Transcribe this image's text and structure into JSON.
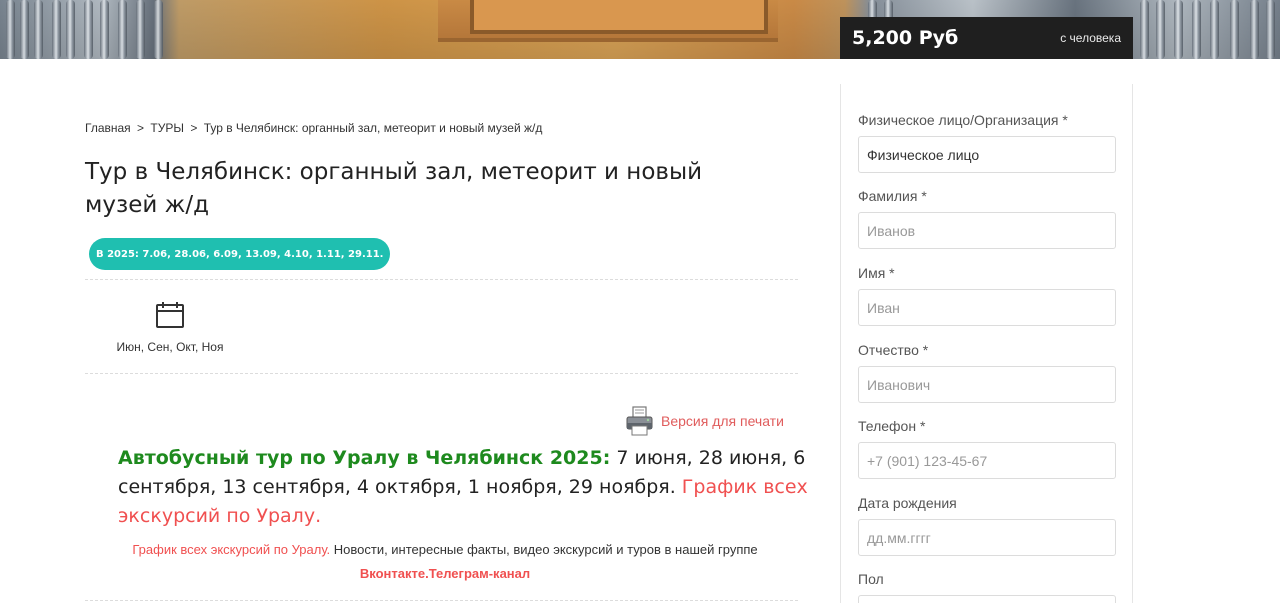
{
  "hero": {
    "price": "5,200 Руб",
    "per_person": "с человека"
  },
  "breadcrumb": {
    "items": [
      "Главная",
      ">",
      "ТУРЫ",
      ">",
      "Тур в Челябинск: органный зал, метеорит и новый музей ж/д"
    ]
  },
  "tour": {
    "title": "Тур в Челябинск: органный зал, метеорит и новый музей ж/д",
    "dates_badge": "В 2025: 7.06, 28.06, 6.09, 13.09, 4.10, 1.11, 29.11.",
    "months_label": "Июн, Сен, Окт, Ноя",
    "print_label": "Версия для печати",
    "lead_green": "Автобусный тур по Уралу в Челябинск 2025:",
    "lead_dates": " 7 июня, 28 июня, 6 сентября, 13 сентября, 4 октября, 1 ноября, 29 ноября.",
    "lead_link": " График всех экскурсий по Уралу.",
    "sub_link": "График всех экскурсий по Уралу.",
    "sub_text": " Новости, интересные факты, видео экскурсий и туров в нашей группе ",
    "sub_vk": "Вконтакте.",
    "sub_tg": "Телеграм-канал"
  },
  "form": {
    "person_type": {
      "label": "Физическое лицо/Организация *",
      "value": "Физическое лицо"
    },
    "last_name": {
      "label": "Фамилия *",
      "placeholder": "Иванов"
    },
    "first_name": {
      "label": "Имя *",
      "placeholder": "Иван"
    },
    "patronymic": {
      "label": "Отчество *",
      "placeholder": "Иванович"
    },
    "phone": {
      "label": "Телефон *",
      "placeholder": "+7 (901) 123-45-67"
    },
    "birth_date": {
      "label": "Дата рождения",
      "placeholder": "дд.мм.гггг"
    },
    "gender": {
      "label": "Пол"
    }
  },
  "colors": {
    "badge": "#1fbfb0",
    "link_red": "#f05050",
    "lead_green": "#1e8a1e",
    "price_bg": "#1f1f1f"
  },
  "icons": [
    "calendar-icon",
    "printer-icon"
  ]
}
